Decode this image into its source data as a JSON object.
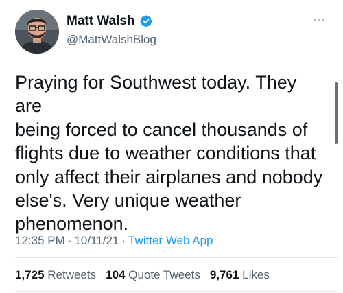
{
  "author": {
    "display_name": "Matt Walsh",
    "handle": "@MattWalshBlog",
    "verified": true
  },
  "tweet": {
    "text": "Praying for Southwest today. They are\nbeing forced to cancel thousands of\nflights due to weather conditions that\nonly affect their airplanes and nobody\nelse's. Very unique weather\nphenomenon.",
    "time": "12:35 PM",
    "date": "10/11/21",
    "separator": "·",
    "source": "Twitter Web App"
  },
  "stats": {
    "retweets_count": "1,725",
    "retweets_label": "Retweets",
    "quotes_count": "104",
    "quotes_label": "Quote Tweets",
    "likes_count": "9,761",
    "likes_label": "Likes"
  },
  "icons": {
    "verified": "verified-badge-icon",
    "more": "more-options-icon"
  },
  "colors": {
    "accent": "#1d9bf0",
    "text_primary": "#0f1419",
    "text_secondary": "#536471",
    "divider": "#e6e9ec"
  }
}
